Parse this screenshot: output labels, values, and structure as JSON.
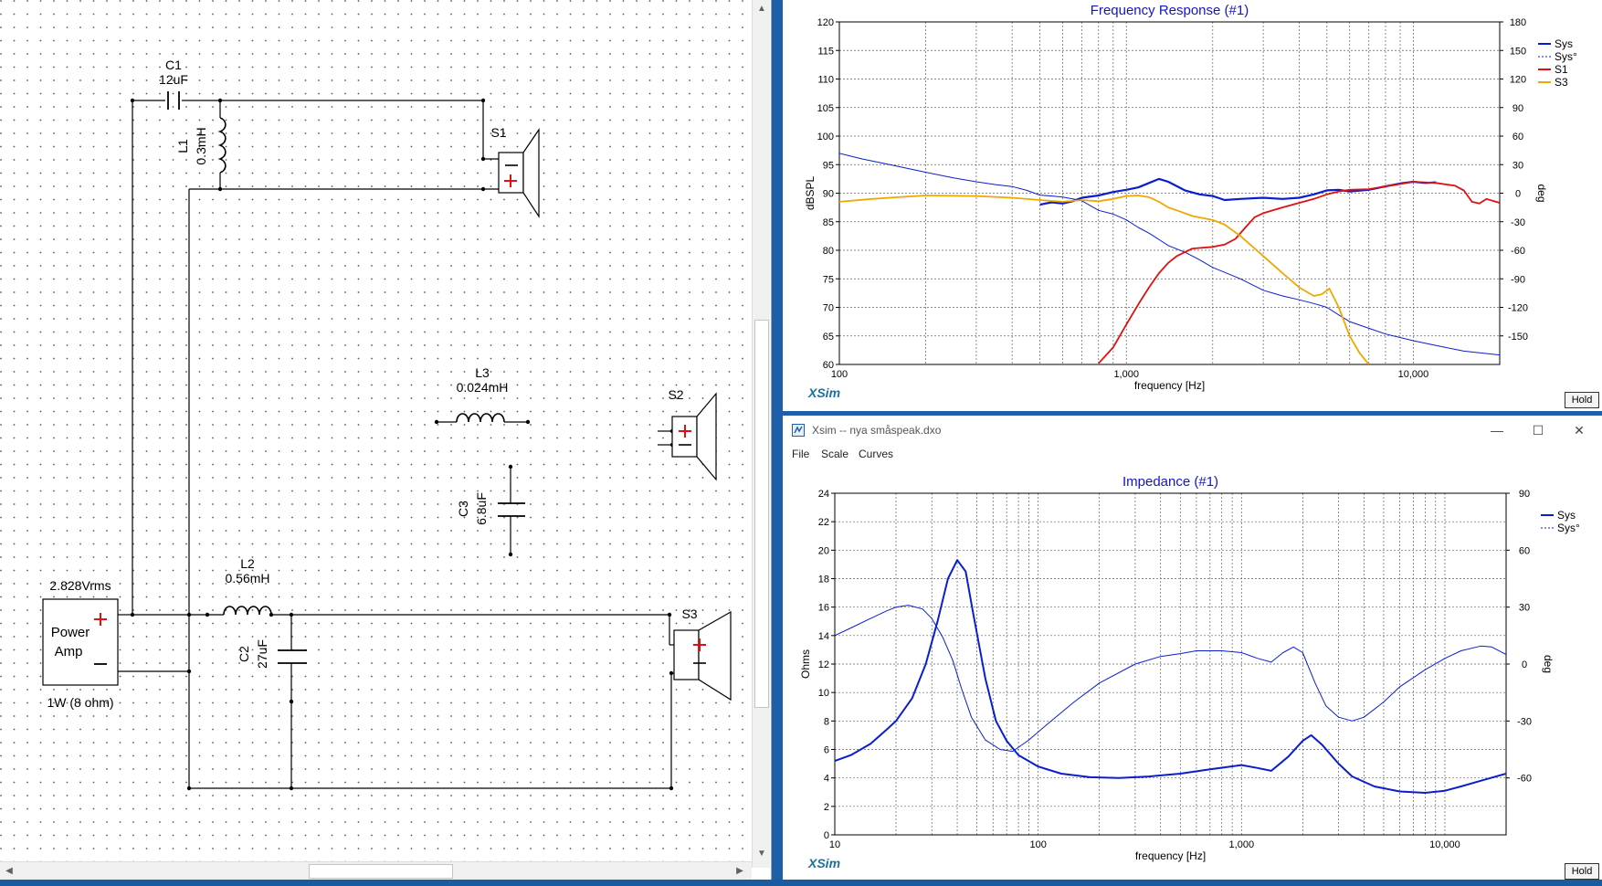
{
  "schematic": {
    "components": {
      "c1": {
        "name": "C1",
        "value": "12uF"
      },
      "l1": {
        "name": "L1",
        "value": "0.3mH"
      },
      "s1": {
        "name": "S1"
      },
      "l3": {
        "name": "L3",
        "value": "0.024mH"
      },
      "s2": {
        "name": "S2"
      },
      "c3": {
        "name": "C3",
        "value": "6.8uF"
      },
      "l2": {
        "name": "L2",
        "value": "0.56mH"
      },
      "c2": {
        "name": "C2",
        "value": "27uF"
      },
      "s3": {
        "name": "S3"
      },
      "amp": {
        "voltage": "2.828Vrms",
        "line1": "Power",
        "line2": "Amp",
        "power": "1W (8 ohm)"
      }
    }
  },
  "freq_window": {
    "hold_label": "Hold",
    "logo": "XSim"
  },
  "imp_window": {
    "title": "Xsim -- nya småspeak.dxo",
    "menu": [
      "File",
      "Scale",
      "Curves"
    ],
    "hold_label": "Hold",
    "logo": "XSim"
  },
  "colors": {
    "sys": "#0a1ecf",
    "s1": "#e01010",
    "s3": "#f0a800",
    "grid": "#606060",
    "title": "#1414c8"
  },
  "chart_data": [
    {
      "type": "line",
      "title": "Frequency Response (#1)",
      "xlabel": "frequency [Hz]",
      "ylabel": "dBSPL",
      "y2label": "deg",
      "xscale": "log",
      "xlim": [
        100,
        20000
      ],
      "ylim": [
        60,
        120
      ],
      "y2lim": [
        -180,
        180
      ],
      "xticks": [
        {
          "v": 100,
          "label": "100"
        },
        {
          "v": 1000,
          "label": "1,000"
        },
        {
          "v": 10000,
          "label": "10,000"
        }
      ],
      "yticks": [
        60,
        65,
        70,
        75,
        80,
        85,
        90,
        95,
        100,
        105,
        110,
        115,
        120
      ],
      "y2ticks": [
        -150,
        -120,
        -90,
        -60,
        -30,
        0,
        30,
        60,
        90,
        120,
        150,
        180
      ],
      "legend_position": "right",
      "series": [
        {
          "name": "Sys",
          "axis": "y",
          "color": "#0a1ecf",
          "style": "solid",
          "width": 2.2,
          "points": [
            [
              500,
              88
            ],
            [
              550,
              88.4
            ],
            [
              600,
              88.2
            ],
            [
              650,
              88.6
            ],
            [
              700,
              89.2
            ],
            [
              800,
              89.6
            ],
            [
              900,
              90.2
            ],
            [
              1000,
              90.6
            ],
            [
              1100,
              91
            ],
            [
              1200,
              91.8
            ],
            [
              1300,
              92.5
            ],
            [
              1400,
              92
            ],
            [
              1600,
              90.5
            ],
            [
              1800,
              89.8
            ],
            [
              2000,
              89.5
            ],
            [
              2200,
              88.8
            ],
            [
              2500,
              89
            ],
            [
              3000,
              89.2
            ],
            [
              3500,
              89
            ],
            [
              4000,
              89.2
            ],
            [
              4500,
              89.8
            ],
            [
              5000,
              90.5
            ],
            [
              5500,
              90.6
            ],
            [
              6000,
              90.3
            ],
            [
              7000,
              90.6
            ],
            [
              8000,
              91.2
            ],
            [
              9000,
              91.7
            ],
            [
              10000,
              92
            ],
            [
              11000,
              91.8
            ],
            [
              12000,
              91.9
            ]
          ]
        },
        {
          "name": "Sys°",
          "axis": "y2",
          "color": "#0a1ecf",
          "style": "solid",
          "width": 1,
          "points": [
            [
              100,
              42
            ],
            [
              120,
              36
            ],
            [
              150,
              30
            ],
            [
              200,
              22
            ],
            [
              250,
              16
            ],
            [
              300,
              12
            ],
            [
              350,
              9
            ],
            [
              400,
              7
            ],
            [
              450,
              3
            ],
            [
              500,
              -2
            ],
            [
              550,
              -3
            ],
            [
              600,
              -4
            ],
            [
              650,
              -6
            ],
            [
              700,
              -8
            ],
            [
              800,
              -18
            ],
            [
              900,
              -22
            ],
            [
              1000,
              -28
            ],
            [
              1100,
              -36
            ],
            [
              1200,
              -42
            ],
            [
              1400,
              -55
            ],
            [
              1600,
              -62
            ],
            [
              1800,
              -70
            ],
            [
              2000,
              -78
            ],
            [
              2500,
              -90
            ],
            [
              3000,
              -102
            ],
            [
              3500,
              -108
            ],
            [
              4000,
              -112
            ],
            [
              4500,
              -116
            ],
            [
              5000,
              -120
            ],
            [
              5500,
              -128
            ],
            [
              6000,
              -135
            ],
            [
              7000,
              -142
            ],
            [
              8000,
              -148
            ],
            [
              10000,
              -155
            ],
            [
              12000,
              -160
            ],
            [
              15000,
              -166
            ],
            [
              20000,
              -170
            ]
          ]
        },
        {
          "name": "S1",
          "axis": "y",
          "color": "#e01010",
          "style": "solid",
          "width": 1.8,
          "points": [
            [
              800,
              60.2
            ],
            [
              900,
              63
            ],
            [
              1000,
              67
            ],
            [
              1100,
              70.5
            ],
            [
              1200,
              73.5
            ],
            [
              1300,
              76
            ],
            [
              1400,
              77.8
            ],
            [
              1500,
              79
            ],
            [
              1700,
              80.3
            ],
            [
              2000,
              80.6
            ],
            [
              2200,
              81
            ],
            [
              2400,
              82
            ],
            [
              2600,
              84
            ],
            [
              2800,
              85.8
            ],
            [
              3000,
              86.5
            ],
            [
              3500,
              87.5
            ],
            [
              4000,
              88.3
            ],
            [
              4500,
              89
            ],
            [
              5000,
              89.8
            ],
            [
              5500,
              90.3
            ],
            [
              6000,
              90.6
            ],
            [
              7000,
              90.7
            ],
            [
              8000,
              91.2
            ],
            [
              9000,
              91.6
            ],
            [
              10000,
              92
            ],
            [
              12000,
              91.8
            ],
            [
              14000,
              91.3
            ],
            [
              15000,
              90.5
            ],
            [
              16000,
              88.5
            ],
            [
              17000,
              88.2
            ],
            [
              18000,
              89
            ],
            [
              20000,
              88.3
            ]
          ]
        },
        {
          "name": "S3",
          "axis": "y",
          "color": "#f0a800",
          "style": "solid",
          "width": 1.8,
          "points": [
            [
              100,
              88.5
            ],
            [
              130,
              89
            ],
            [
              160,
              89.3
            ],
            [
              200,
              89.6
            ],
            [
              300,
              89.5
            ],
            [
              400,
              89.2
            ],
            [
              500,
              88.8
            ],
            [
              600,
              88.5
            ],
            [
              700,
              88.8
            ],
            [
              800,
              88.6
            ],
            [
              900,
              89
            ],
            [
              1000,
              89.5
            ],
            [
              1100,
              89.6
            ],
            [
              1200,
              89.3
            ],
            [
              1300,
              88.5
            ],
            [
              1400,
              87.5
            ],
            [
              1500,
              87
            ],
            [
              1700,
              86
            ],
            [
              2000,
              85.3
            ],
            [
              2200,
              84.5
            ],
            [
              2500,
              82.5
            ],
            [
              3000,
              79
            ],
            [
              3500,
              76
            ],
            [
              4000,
              73.5
            ],
            [
              4500,
              72
            ],
            [
              4800,
              72.3
            ],
            [
              5100,
              73.3
            ],
            [
              5500,
              70
            ],
            [
              6000,
              65
            ],
            [
              6500,
              62
            ],
            [
              7000,
              60
            ]
          ]
        }
      ]
    },
    {
      "type": "line",
      "title": "Impedance (#1)",
      "xlabel": "frequency [Hz]",
      "ylabel": "Ohms",
      "y2label": "deg",
      "xscale": "log",
      "xlim": [
        10,
        20000
      ],
      "ylim": [
        0,
        24
      ],
      "y2lim": [
        -90,
        90
      ],
      "xticks": [
        {
          "v": 10,
          "label": "10"
        },
        {
          "v": 100,
          "label": "100"
        },
        {
          "v": 1000,
          "label": "1,000"
        },
        {
          "v": 10000,
          "label": "10,000"
        }
      ],
      "yticks": [
        0,
        2,
        4,
        6,
        8,
        10,
        12,
        14,
        16,
        18,
        20,
        22,
        24
      ],
      "y2ticks": [
        -60,
        -30,
        0,
        30,
        60,
        90
      ],
      "legend_position": "right",
      "series": [
        {
          "name": "Sys",
          "axis": "y",
          "color": "#0a1ecf",
          "style": "solid",
          "width": 2,
          "points": [
            [
              10,
              5.2
            ],
            [
              12,
              5.6
            ],
            [
              15,
              6.4
            ],
            [
              18,
              7.4
            ],
            [
              20,
              8
            ],
            [
              24,
              9.6
            ],
            [
              28,
              12
            ],
            [
              32,
              15
            ],
            [
              36,
              18
            ],
            [
              40,
              19.3
            ],
            [
              44,
              18.5
            ],
            [
              48,
              15.5
            ],
            [
              55,
              11
            ],
            [
              62,
              8
            ],
            [
              70,
              6.6
            ],
            [
              80,
              5.6
            ],
            [
              100,
              4.8
            ],
            [
              130,
              4.3
            ],
            [
              180,
              4.05
            ],
            [
              250,
              4
            ],
            [
              350,
              4.1
            ],
            [
              500,
              4.3
            ],
            [
              700,
              4.6
            ],
            [
              1000,
              4.9
            ],
            [
              1200,
              4.7
            ],
            [
              1400,
              4.5
            ],
            [
              1700,
              5.5
            ],
            [
              2000,
              6.6
            ],
            [
              2200,
              7
            ],
            [
              2500,
              6.3
            ],
            [
              3000,
              5
            ],
            [
              3500,
              4.1
            ],
            [
              4500,
              3.4
            ],
            [
              6000,
              3.05
            ],
            [
              8000,
              2.95
            ],
            [
              10000,
              3.1
            ],
            [
              12000,
              3.4
            ],
            [
              15000,
              3.8
            ],
            [
              20000,
              4.3
            ]
          ]
        },
        {
          "name": "Sys°",
          "axis": "y2",
          "color": "#0a1ecf",
          "style": "solid",
          "width": 1,
          "points": [
            [
              10,
              15
            ],
            [
              12,
              19
            ],
            [
              15,
              24
            ],
            [
              18,
              28
            ],
            [
              20,
              30
            ],
            [
              23,
              31
            ],
            [
              27,
              29
            ],
            [
              30,
              24
            ],
            [
              34,
              14
            ],
            [
              38,
              2
            ],
            [
              42,
              -13
            ],
            [
              47,
              -28
            ],
            [
              55,
              -40
            ],
            [
              65,
              -45
            ],
            [
              75,
              -46
            ],
            [
              90,
              -40
            ],
            [
              110,
              -32
            ],
            [
              150,
              -20
            ],
            [
              200,
              -10
            ],
            [
              300,
              0
            ],
            [
              400,
              4
            ],
            [
              500,
              5.5
            ],
            [
              600,
              7
            ],
            [
              800,
              7
            ],
            [
              1000,
              6
            ],
            [
              1200,
              3
            ],
            [
              1400,
              1
            ],
            [
              1600,
              6
            ],
            [
              1800,
              9
            ],
            [
              2000,
              6
            ],
            [
              2300,
              -10
            ],
            [
              2600,
              -22
            ],
            [
              3000,
              -28
            ],
            [
              3500,
              -30
            ],
            [
              4000,
              -28
            ],
            [
              5000,
              -20
            ],
            [
              6000,
              -12
            ],
            [
              8000,
              -3
            ],
            [
              10000,
              3
            ],
            [
              12000,
              7
            ],
            [
              15000,
              9.5
            ],
            [
              17000,
              9
            ],
            [
              20000,
              5
            ]
          ]
        }
      ]
    }
  ]
}
